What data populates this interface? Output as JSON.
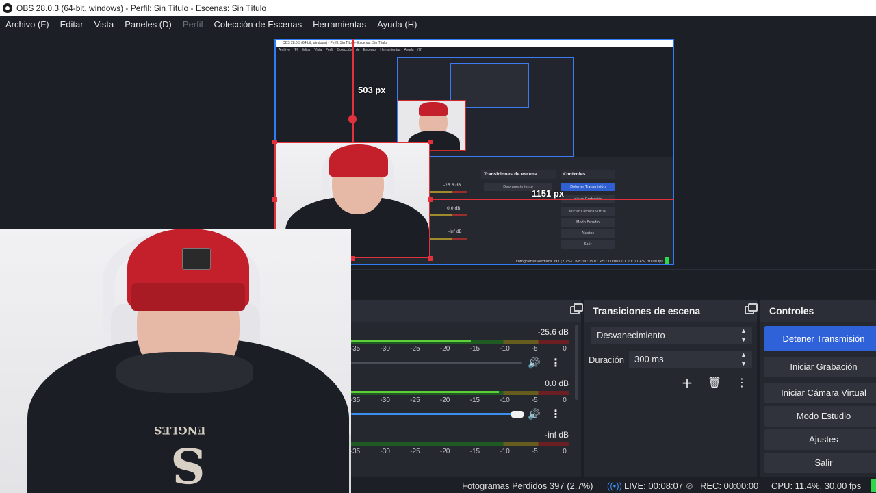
{
  "window": {
    "title": "OBS 28.0.3 (64-bit, windows) - Perfil: Sin Título - Escenas: Sin Título",
    "minimize": "—"
  },
  "menu": {
    "archivo": "Archivo (F)",
    "editar": "Editar",
    "vista": "Vista",
    "paneles": "Paneles (D)",
    "perfil": "Perfil",
    "coleccion": "Colección de Escenas",
    "herramientas": "Herramientas",
    "ayuda": "Ayuda (H)"
  },
  "preview": {
    "height_measure": "503 px",
    "width_measure": "1151 px",
    "mini_title": "OBS 28.0.3 (64-bit, windows) - Perfil: Sin Título - Escenas: Sin Título",
    "mini_menu": "Archivo (F) Editar Vista Perfil Colección de Escenas Herramientas Ayuda (H)",
    "mini_transitions": "Transiciones de escena",
    "mini_controls": "Controles",
    "mini_fade": "Desvanecimiento",
    "mini_db1": "-25.6 dB",
    "mini_db2": "0.0 dB",
    "mini_db3": "-inf dB",
    "mini_buttons": [
      "Detener Transmisión",
      "Iniciar Grabación",
      "Iniciar Cámara Virtual",
      "Modo Estudio",
      "Ajustes",
      "Salir"
    ],
    "mini_status": "Fotogramas Perdidos 397 (2.7%)   LIVE: 00:08:07   REC: 00:00:00   CPU: 11.4%, 30.00 fps"
  },
  "mixer": {
    "channels": [
      {
        "db": "-25.6 dB",
        "level": 0.55,
        "volume": null
      },
      {
        "db": "0.0 dB",
        "level": 0.68,
        "volume": 0.97
      },
      {
        "db": "-inf dB",
        "level": 0.0,
        "volume": null
      }
    ],
    "scale": [
      "-35",
      "-30",
      "-25",
      "-20",
      "-15",
      "-10",
      "-5",
      "0"
    ]
  },
  "transitions": {
    "title": "Transiciones de escena",
    "selected": "Desvanecimiento",
    "duration_label": "Duración",
    "duration_value": "300 ms"
  },
  "controls": {
    "title": "Controles",
    "stop_stream": "Detener Transmisión",
    "start_recording": "Iniciar Grabación",
    "start_virtual_cam": "Iniciar Cámara Virtual",
    "studio_mode": "Modo Estudio",
    "settings": "Ajustes",
    "exit": "Salir"
  },
  "status": {
    "dropped_frames": "Fotogramas Perdidos 397 (2.7%)",
    "live": "LIVE: 00:08:07",
    "rec": "REC: 00:00:00",
    "cpu": "CPU: 11.4%, 30.00 fps"
  },
  "webcam": {
    "shirt_print": "ENGLES"
  },
  "colors": {
    "accent": "#2f62d9",
    "selection": "#e0313c",
    "canvas_border": "#2f7df6",
    "ok": "#2fd84a"
  }
}
